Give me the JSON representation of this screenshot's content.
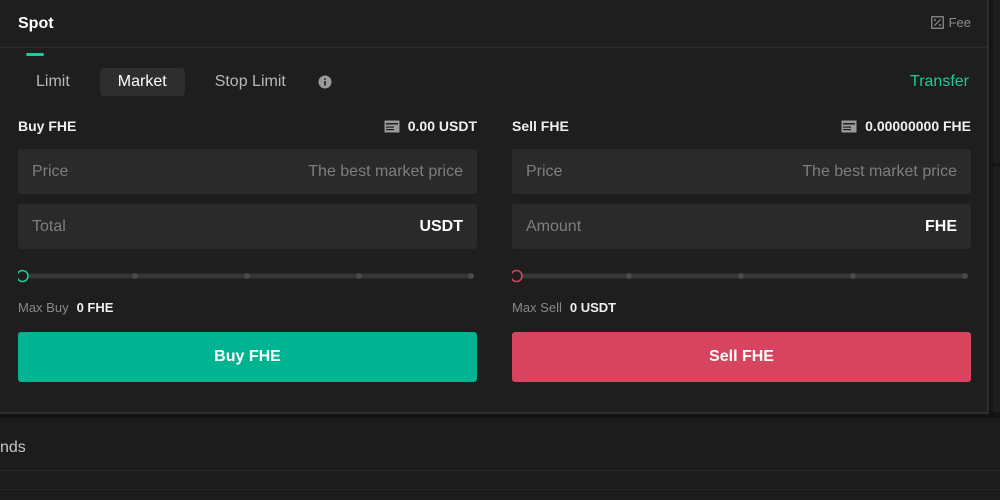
{
  "header": {
    "spot_tab": "Spot",
    "fee_label": "Fee"
  },
  "order_tabs": [
    {
      "label": "Limit",
      "active": false
    },
    {
      "label": "Market",
      "active": true
    },
    {
      "label": "Stop Limit",
      "active": false
    }
  ],
  "transfer_label": "Transfer",
  "buy": {
    "title": "Buy FHE",
    "balance": "0.00 USDT",
    "price_label": "Price",
    "price_hint": "The best market price",
    "total_label": "Total",
    "total_unit": "USDT",
    "slider_percent": 0,
    "max_label": "Max Buy",
    "max_value": "0 FHE",
    "button_label": "Buy FHE"
  },
  "sell": {
    "title": "Sell FHE",
    "balance": "0.00000000 FHE",
    "price_label": "Price",
    "price_hint": "The best market price",
    "amount_label": "Amount",
    "amount_unit": "FHE",
    "slider_percent": 0,
    "max_label": "Max Sell",
    "max_value": "0 USDT",
    "button_label": "Sell FHE"
  },
  "bottom": {
    "label": "nds"
  },
  "colors": {
    "accent_green": "#20c997",
    "buy_button": "#00b492",
    "sell_button": "#d6445e",
    "panel_bg": "#1e1e1e"
  },
  "icons": {
    "fee": "fee-percent-icon",
    "info": "info-icon",
    "wallet": "wallet-icon"
  }
}
